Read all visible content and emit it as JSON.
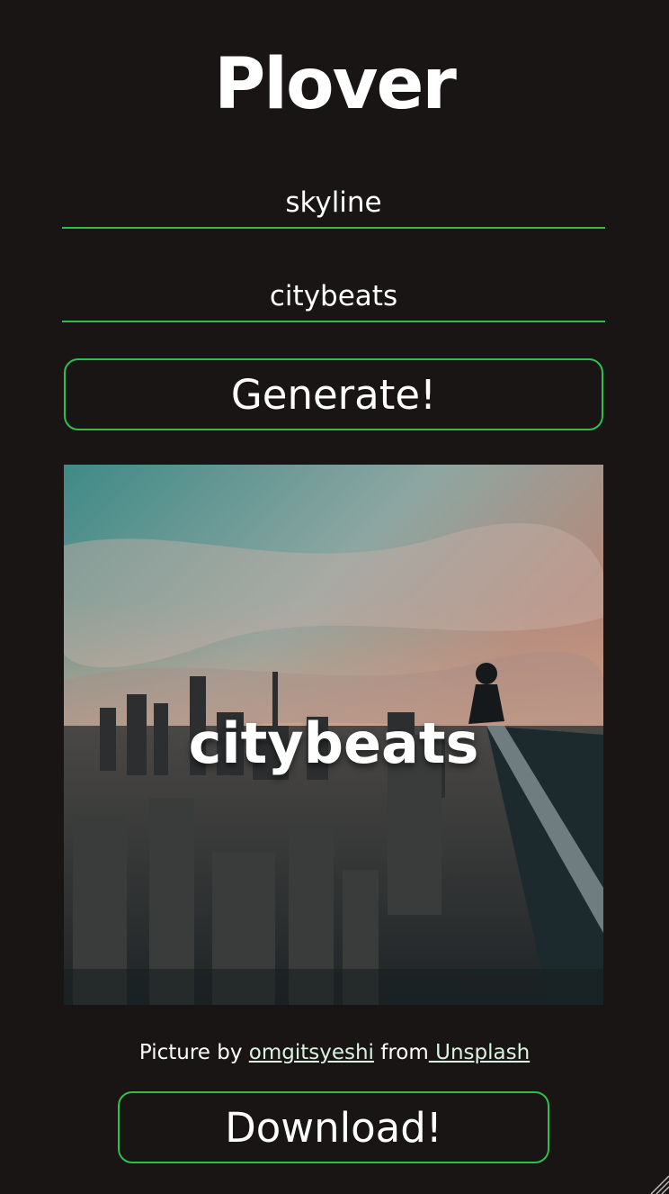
{
  "app": {
    "title": "Plover"
  },
  "form": {
    "keyword_value": "skyline",
    "name_value": "citybeats",
    "generate_label": "Generate!"
  },
  "cover": {
    "overlay_text": "citybeats"
  },
  "credit": {
    "prefix": "Picture by ",
    "author": "omgitsyeshi",
    "middle": " from",
    "source": " Unsplash"
  },
  "download": {
    "label": "Download!"
  },
  "colors": {
    "background": "#191514",
    "accent": "#2fbf4e",
    "link": "#d9f3e0"
  },
  "icons": {
    "corner": "resize-grip-icon"
  }
}
